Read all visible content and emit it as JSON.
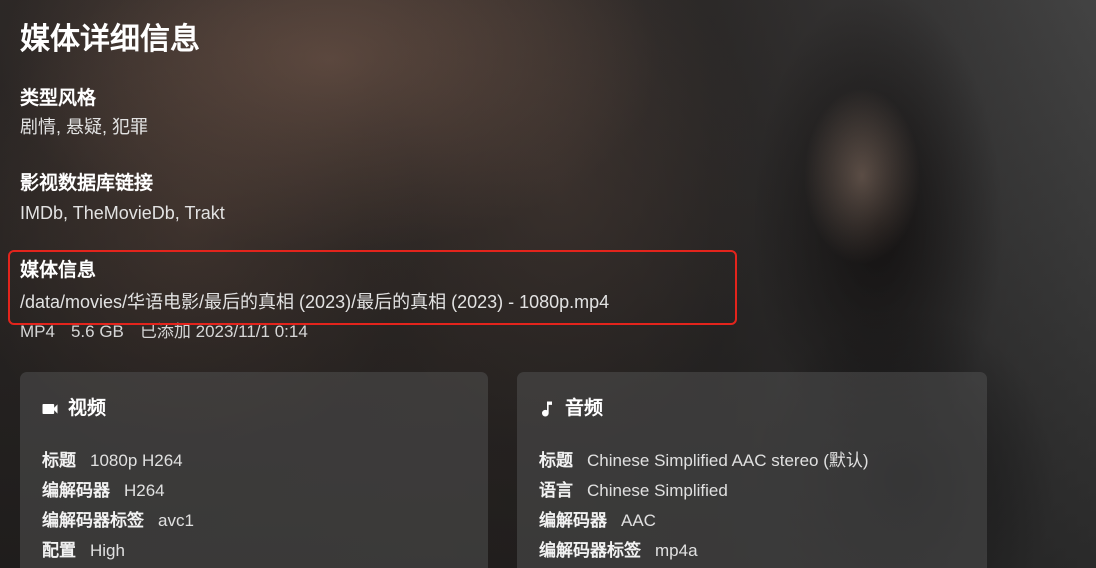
{
  "page": {
    "title": "媒体详细信息"
  },
  "details": {
    "genres": {
      "heading": "类型风格",
      "items": [
        "剧情",
        "悬疑",
        "犯罪"
      ],
      "separator": ", "
    },
    "external_links": {
      "heading": "影视数据库链接",
      "items": [
        "IMDb",
        "TheMovieDb",
        "Trakt"
      ],
      "separator": ", "
    },
    "media_info": {
      "heading": "媒体信息",
      "path": "/data/movies/华语电影/最后的真相 (2023)/最后的真相 (2023) - 1080p.mp4",
      "container": "MP4",
      "size": "5.6 GB",
      "added": "已添加 2023/11/1 0:14"
    }
  },
  "streams": {
    "video": {
      "title": "视频",
      "icon": "video-camera-icon",
      "rows": [
        {
          "label": "标题",
          "value": "1080p H264"
        },
        {
          "label": "编解码器",
          "value": "H264"
        },
        {
          "label": "编解码器标签",
          "value": "avc1"
        },
        {
          "label": "配置",
          "value": "High"
        }
      ]
    },
    "audio": {
      "title": "音频",
      "icon": "music-note-icon",
      "rows": [
        {
          "label": "标题",
          "value": "Chinese Simplified AAC stereo (默认)"
        },
        {
          "label": "语言",
          "value": "Chinese Simplified"
        },
        {
          "label": "编解码器",
          "value": "AAC"
        },
        {
          "label": "编解码器标签",
          "value": "mp4a"
        }
      ]
    }
  },
  "colors": {
    "highlight": "#e3241c",
    "background": "#2b2a29",
    "card_background": "rgba(80,80,80,0.55)",
    "text": "#ffffff",
    "muted_text": "#e2e2e2"
  }
}
